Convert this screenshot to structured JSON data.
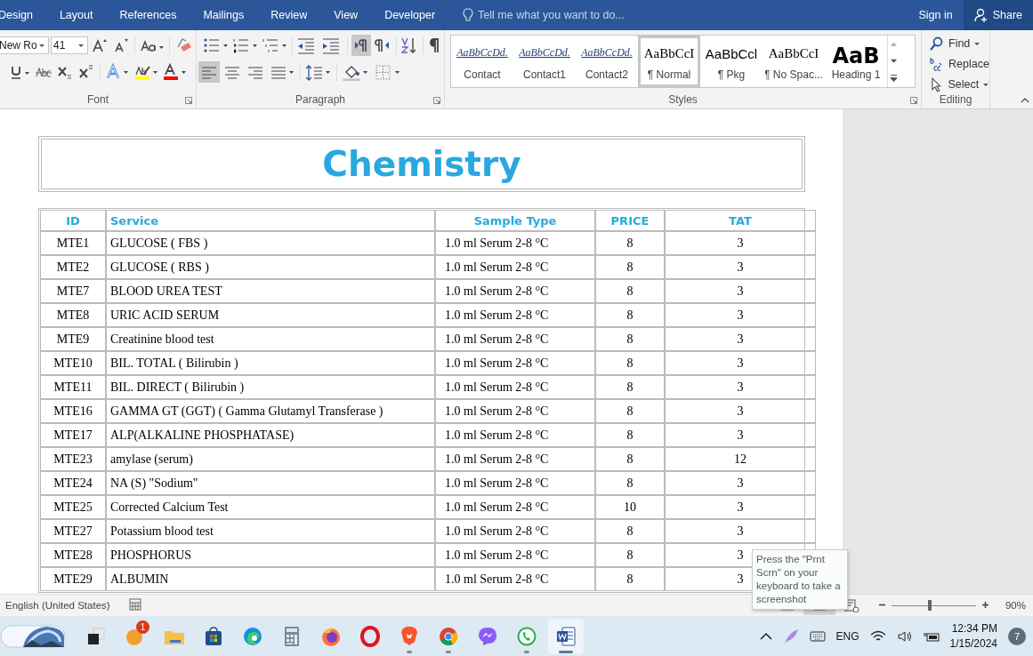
{
  "ribbon_tabs": [
    {
      "label": "Design",
      "selected": false
    },
    {
      "label": "Layout",
      "selected": false
    },
    {
      "label": "References",
      "selected": false
    },
    {
      "label": "Mailings",
      "selected": false
    },
    {
      "label": "Review",
      "selected": false
    },
    {
      "label": "View",
      "selected": false
    },
    {
      "label": "Developer",
      "selected": false
    }
  ],
  "tell_me": {
    "placeholder": "Tell me what you want to do..."
  },
  "sign_in": "Sign in",
  "share": "Share",
  "font_group": {
    "label": "Font",
    "font_name": "New Ro",
    "font_size": "41",
    "row1": [
      {
        "kind": "grow",
        "on": false
      },
      {
        "kind": "shrink",
        "on": false
      },
      {
        "kind": "case",
        "on": false
      },
      {
        "kind": "clear",
        "on": false
      }
    ],
    "row2": [
      {
        "kind": "underline",
        "on": false
      },
      {
        "kind": "strike",
        "on": false
      },
      {
        "kind": "sub",
        "on": false
      },
      {
        "kind": "sup",
        "on": false
      },
      {
        "kind": "effects",
        "on": false
      },
      {
        "kind": "highlight",
        "on": false
      },
      {
        "kind": "fontcolor",
        "on": false
      }
    ]
  },
  "paragraph_group": {
    "label": "Paragraph",
    "row1": [
      {
        "kind": "bullets",
        "on": false
      },
      {
        "kind": "numbering",
        "on": false
      },
      {
        "kind": "multilevel",
        "on": false
      },
      {
        "kind": "outdent",
        "on": false
      },
      {
        "kind": "indent",
        "on": false
      },
      {
        "kind": "ltr",
        "on": true
      },
      {
        "kind": "rtl",
        "on": false
      },
      {
        "kind": "sort",
        "on": false
      },
      {
        "kind": "pilcrow",
        "on": false
      }
    ],
    "row2": [
      {
        "kind": "alignleft",
        "on": true
      },
      {
        "kind": "center",
        "on": false
      },
      {
        "kind": "alignright",
        "on": false
      },
      {
        "kind": "justify",
        "on": false
      },
      {
        "kind": "spacing",
        "on": false
      },
      {
        "kind": "shading",
        "on": false
      },
      {
        "kind": "borders",
        "on": false
      }
    ]
  },
  "styles_group": {
    "label": "Styles",
    "styles": [
      {
        "preview": "AaBbCcDd.",
        "name": "Contact",
        "kind": "contact",
        "selected": false
      },
      {
        "preview": "AaBbCcDd.",
        "name": "Contact1",
        "kind": "contact",
        "selected": false
      },
      {
        "preview": "AaBbCcDd.",
        "name": "Contact2",
        "kind": "contact",
        "selected": false
      },
      {
        "preview": "AaBbCcI",
        "name": "¶ Normal",
        "kind": "serif",
        "selected": true
      },
      {
        "preview": "AaBbCcl",
        "name": "¶ Pkg",
        "kind": "sans",
        "selected": false
      },
      {
        "preview": "AaBbCcI",
        "name": "¶ No Spac...",
        "kind": "serif",
        "selected": false
      },
      {
        "preview": "AaB",
        "name": "Heading 1",
        "kind": "heading",
        "selected": false
      }
    ]
  },
  "editing_group": {
    "label": "Editing",
    "items": [
      {
        "label": "Find",
        "kind": "find"
      },
      {
        "label": "Replace",
        "kind": "replace"
      },
      {
        "label": "Select",
        "kind": "select"
      }
    ]
  },
  "document": {
    "title": "Chemistry",
    "columns": [
      "ID",
      "Service",
      "Sample Type",
      "PRICE",
      "TAT"
    ],
    "rows": [
      [
        "MTE1",
        "GLUCOSE ( FBS )",
        "1.0 ml Serum 2-8 °C",
        "8",
        "3"
      ],
      [
        "MTE2",
        "GLUCOSE ( RBS )",
        "1.0 ml Serum 2-8 °C",
        "8",
        "3"
      ],
      [
        "MTE7",
        "BLOOD UREA TEST",
        "1.0 ml Serum 2-8 °C",
        "8",
        "3"
      ],
      [
        "MTE8",
        "URIC ACID SERUM",
        "1.0 ml Serum 2-8 °C",
        "8",
        "3"
      ],
      [
        "MTE9",
        "Creatinine blood test",
        "1.0 ml Serum 2-8 °C",
        "8",
        "3"
      ],
      [
        "MTE10",
        "BIL. TOTAL ( Bilirubin )",
        "1.0 ml Serum 2-8 °C",
        "8",
        "3"
      ],
      [
        "MTE11",
        "BIL. DIRECT ( Bilirubin )",
        "1.0 ml Serum 2-8 °C",
        "8",
        "3"
      ],
      [
        "MTE16",
        "GAMMA GT (GGT) ( Gamma Glutamyl Transferase )",
        "1.0 ml Serum 2-8 °C",
        "8",
        "3"
      ],
      [
        "MTE17",
        "ALP(ALKALINE PHOSPHATASE)",
        "1.0 ml Serum 2-8 °C",
        "8",
        "3"
      ],
      [
        "MTE23",
        "amylase (serum)",
        "1.0 ml Serum 2-8 °C",
        "8",
        "12"
      ],
      [
        "MTE24",
        "NA (S) \"Sodium\"",
        "1.0 ml Serum 2-8 °C",
        "8",
        "3"
      ],
      [
        "MTE25",
        "Corrected Calcium Test",
        "1.0 ml Serum 2-8 °C",
        "10",
        "3"
      ],
      [
        "MTE27",
        "Potassium blood test",
        "1.0 ml Serum 2-8 °C",
        "8",
        "3"
      ],
      [
        "MTE28",
        "PHOSPHORUS",
        "1.0 ml Serum 2-8 °C",
        "8",
        "3"
      ],
      [
        "MTE29",
        "ALBUMIN",
        "1.0 ml Serum 2-8 °C",
        "8",
        "3"
      ]
    ]
  },
  "tooltip": "Press the \"Prnt Scrn\" on your keyboard to take a screenshot",
  "status_bar": {
    "language": "English (United States)",
    "views": [
      {
        "kind": "read",
        "selected": false
      },
      {
        "kind": "print",
        "selected": true
      },
      {
        "kind": "web",
        "selected": false
      }
    ],
    "zoom": {
      "level": 0.45,
      "reading": "90%"
    }
  },
  "taskbar": {
    "apps": [
      {
        "kind": "widgets",
        "running": false,
        "selected": false
      },
      {
        "kind": "taskview",
        "running": false,
        "selected": false
      },
      {
        "kind": "orange",
        "running": false,
        "selected": false,
        "badge": "1"
      },
      {
        "kind": "files",
        "running": false,
        "selected": false
      },
      {
        "kind": "store",
        "running": false,
        "selected": false
      },
      {
        "kind": "edge",
        "running": false,
        "selected": false
      },
      {
        "kind": "calculator",
        "running": false,
        "selected": false
      },
      {
        "kind": "firefox",
        "running": false,
        "selected": false
      },
      {
        "kind": "opera",
        "running": false,
        "selected": false
      },
      {
        "kind": "brave",
        "running": true,
        "selected": false
      },
      {
        "kind": "chrome",
        "running": true,
        "selected": false
      },
      {
        "kind": "messenger",
        "running": false,
        "selected": false
      },
      {
        "kind": "whatsapp",
        "running": true,
        "selected": false
      },
      {
        "kind": "word",
        "running": true,
        "selected": true
      }
    ],
    "language": "ENG",
    "time": "12:34 PM",
    "date": "1/15/2024",
    "notifications": "7"
  }
}
